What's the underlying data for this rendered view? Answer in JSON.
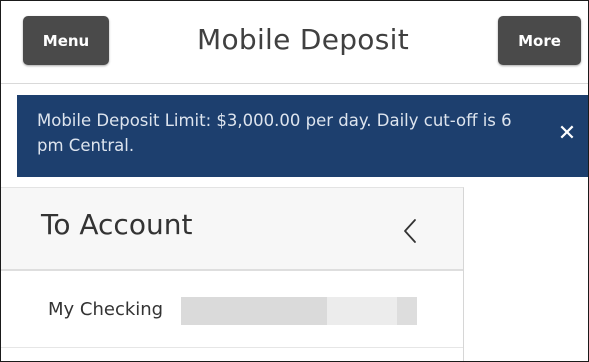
{
  "header": {
    "menu_label": "Menu",
    "title": "Mobile Deposit",
    "more_label": "More"
  },
  "alert": {
    "message": "Mobile Deposit Limit: $3,000.00 per day. Daily cut-off is 6 pm Central.",
    "close_glyph": "✕",
    "background_color": "#1d3f6e"
  },
  "to_account": {
    "title": "To Account",
    "expand_icon": "chevron-left-icon",
    "selected_account": "My Checking"
  },
  "colors": {
    "button_bg": "#4a4a4a",
    "banner_bg": "#1d3f6e"
  }
}
